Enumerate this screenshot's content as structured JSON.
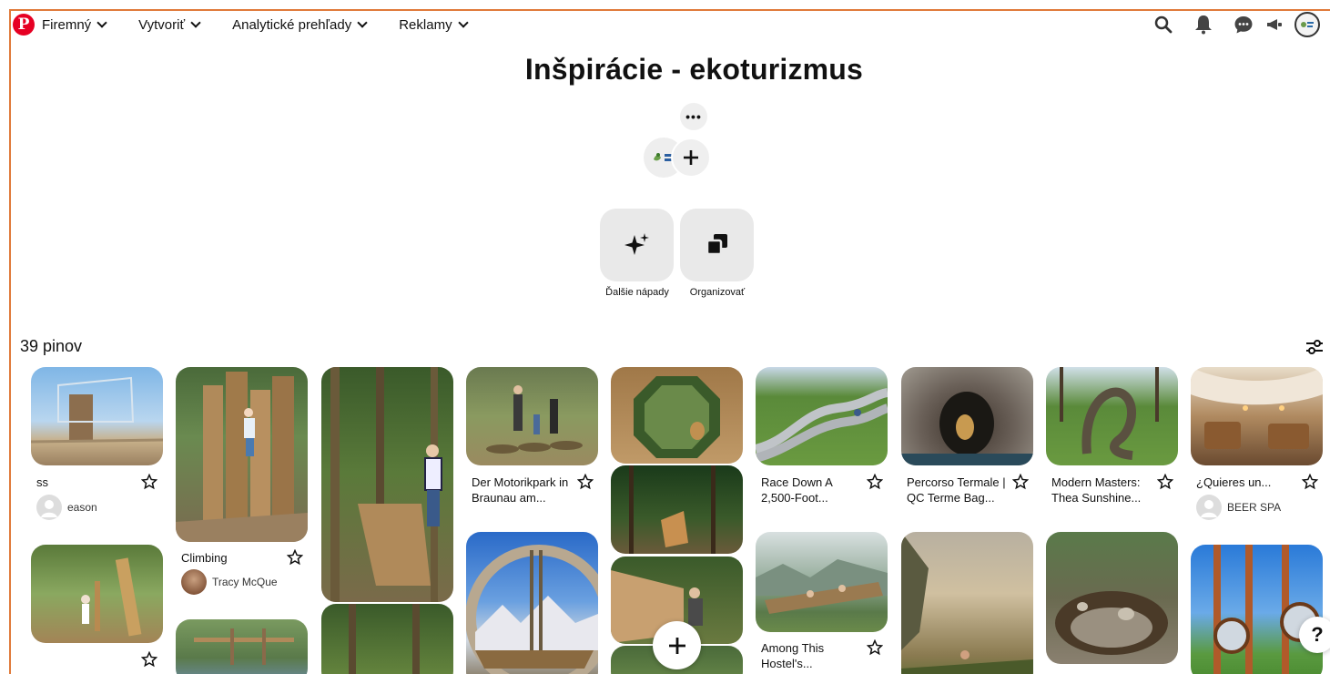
{
  "nav": {
    "items": [
      {
        "label": "Firemný"
      },
      {
        "label": "Vytvoriť"
      },
      {
        "label": "Analytické prehľady"
      },
      {
        "label": "Reklamy"
      }
    ]
  },
  "board": {
    "title": "Inšpirácie - ekoturizmus",
    "more_label": "•••",
    "actions": [
      {
        "label": "Ďalšie nápady",
        "icon": "sparkle-icon"
      },
      {
        "label": "Organizovať",
        "icon": "organize-icon"
      }
    ],
    "pin_count": "39 pinov"
  },
  "pins": [
    {
      "title": "ss",
      "author": "eason"
    },
    {
      "title": "Climbing",
      "author": "Tracy McQue"
    },
    {
      "title": "Der Motorikpark in Braunau am..."
    },
    {
      "title": "Race Down A 2,500-Foot..."
    },
    {
      "title": "Percorso Termale | QC Terme Bag..."
    },
    {
      "title": "Modern Masters: Thea Sunshine..."
    },
    {
      "title": "¿Quieres un...",
      "author": "BEER SPA"
    },
    {
      "title": "Among This Hostel's..."
    }
  ],
  "help_label": "?",
  "colors": {
    "brand": "#e60023",
    "accent_border": "#e07a3a"
  }
}
